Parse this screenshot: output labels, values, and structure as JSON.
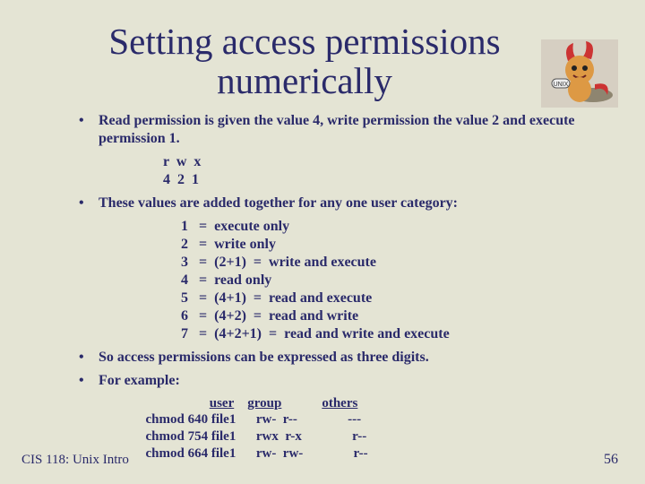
{
  "slide": {
    "title": "Setting access permissions numerically",
    "bullet1": "Read permission is given the value 4, write permission the value 2 and execute permission 1.",
    "rwx_row1": "r w  x",
    "rwx_row2": "4 2 1",
    "bullet2": "These values are added together for any one user category:",
    "perm_rows": [
      "1   =  execute only",
      "2   =  write only",
      "3   =  (2+1)  =  write and execute",
      "4   =  read only",
      "5   =  (4+1)  =  read and execute",
      "6   =  (4+2)  =  read and write",
      "7   =  (4+2+1)  =  read and write and execute"
    ],
    "bullet3": "So access permissions can be expressed as three digits.",
    "bullet4": "For example:",
    "example": {
      "hdr_user": "user",
      "hdr_group": "group",
      "hdr_others": "others",
      "rows": [
        {
          "cmd": "chmod 640 file1",
          "u": "rw-",
          "g": "r--",
          "o": "---"
        },
        {
          "cmd": "chmod 754 file1",
          "u": "rwx",
          "g": "r-x",
          "o": "r--"
        },
        {
          "cmd": "chmod 664 file1",
          "u": "rw-",
          "g": "rw-",
          "o": "r--"
        }
      ]
    }
  },
  "footer": {
    "left": "CIS 118: Unix Intro",
    "right": "56"
  },
  "icon": {
    "label": "bsd-daemon-unix-logo"
  }
}
